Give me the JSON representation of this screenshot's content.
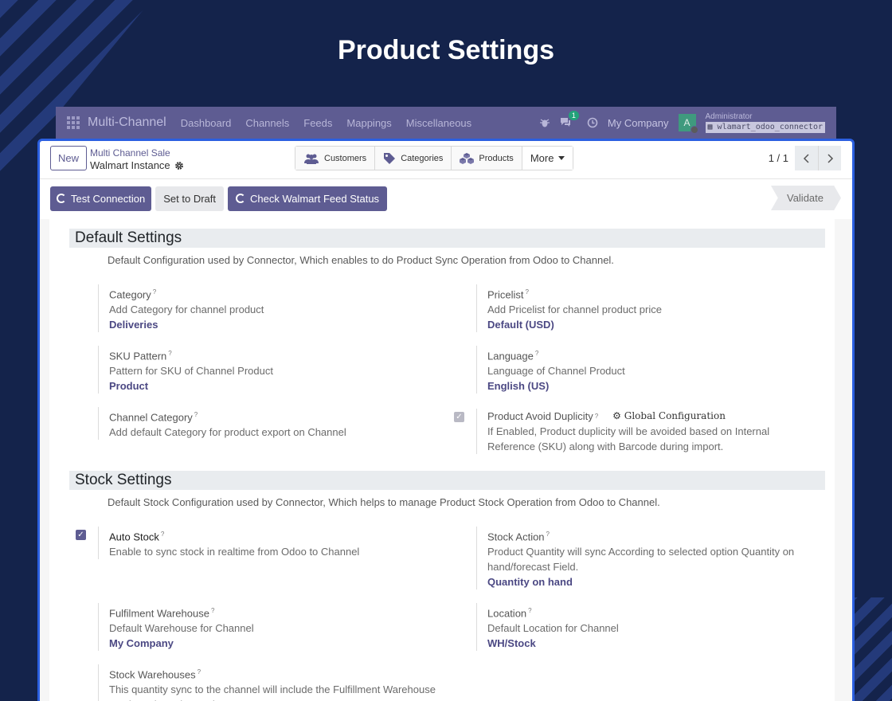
{
  "hero": {
    "title": "Product Settings"
  },
  "navbar": {
    "brand": "Multi-Channel",
    "menu": [
      "Dashboard",
      "Channels",
      "Feeds",
      "Mappings",
      "Miscellaneous"
    ],
    "chat_count": "1",
    "company": "My Company",
    "avatar_initial": "A",
    "user_name": "Administrator",
    "database": "wlamart_odoo_connector"
  },
  "control": {
    "new_label": "New",
    "breadcrumb_parent": "Multi Channel Sale",
    "breadcrumb_current": "Walmart Instance",
    "smart_buttons": [
      "Customers",
      "Categories",
      "Products"
    ],
    "more_label": "More",
    "pager": "1 / 1"
  },
  "statusbar": {
    "test_connection": "Test Connection",
    "set_to_draft": "Set to Draft",
    "check_feed": "Check Walmart Feed Status",
    "validate": "Validate"
  },
  "default_settings": {
    "title": "Default Settings",
    "description": "Default Configuration used by Connector, Which enables to do Product Sync Operation from Odoo to Channel.",
    "category": {
      "label": "Category",
      "help": "Add Category for channel product",
      "value": "Deliveries"
    },
    "pricelist": {
      "label": "Pricelist",
      "help": "Add Pricelist for channel product price",
      "value": "Default (USD)"
    },
    "sku_pattern": {
      "label": "SKU Pattern",
      "help": "Pattern for SKU of Channel Product",
      "value": "Product"
    },
    "language": {
      "label": "Language",
      "help": "Language of Channel Product",
      "value": "English (US)"
    },
    "channel_category": {
      "label": "Channel Category",
      "help": "Add default Category for product export on Channel"
    },
    "avoid_duplicity": {
      "label": "Product Avoid Duplicity",
      "global_config": "Global Configuration",
      "help": "If Enabled, Product duplicity will be avoided based on Internal Reference (SKU) along with Barcode during import."
    }
  },
  "stock_settings": {
    "title": "Stock Settings",
    "description": "Default Stock Configuration used by Connector, Which helps to manage Product Stock Operation from Odoo to Channel.",
    "auto_stock": {
      "label": "Auto Stock",
      "help": "Enable to sync stock in realtime from Odoo to Channel"
    },
    "stock_action": {
      "label": "Stock Action",
      "help": "Product Quantity will sync According to selected option Quantity on hand/forecast Field.",
      "value": "Quantity on hand"
    },
    "fulfilment_warehouse": {
      "label": "Fulfilment Warehouse",
      "help": "Default Warehouse for Channel",
      "value": "My Company"
    },
    "location": {
      "label": "Location",
      "help": "Default Location for Channel",
      "value": "WH/Stock"
    },
    "stock_warehouses": {
      "label": "Stock Warehouses",
      "help": "This quantity sync to the channel will include the Fulfillment Warehouse + selected Stock Warehouses."
    }
  },
  "colors": {
    "accent": "#5e5c92",
    "background": "#14234b",
    "window_border": "#2b5fe0"
  }
}
